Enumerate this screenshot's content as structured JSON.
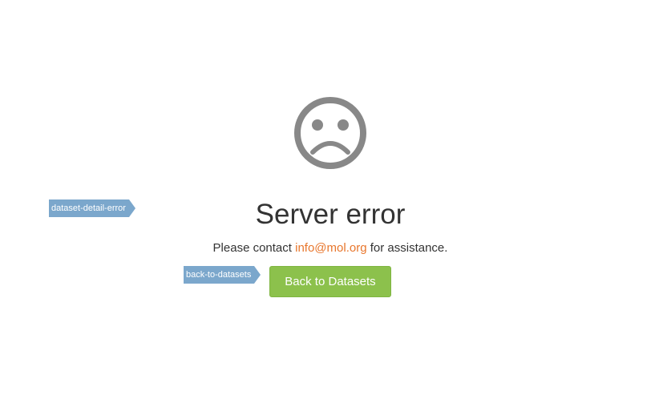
{
  "page": {
    "title": "Server error",
    "message_prefix": "Please contact",
    "contact_email": "info@mol.org",
    "message_suffix": "for assistance.",
    "back_button_label": "Back to Datasets",
    "icon": "sad-face-icon"
  },
  "tags": {
    "error_tag": "dataset-detail-error",
    "back_tag": "back-to-datasets"
  },
  "colors": {
    "icon_gray": "#888888",
    "link_orange": "#e8762c",
    "button_green": "#8cc14c",
    "tag_blue": "#7ba7cc"
  }
}
